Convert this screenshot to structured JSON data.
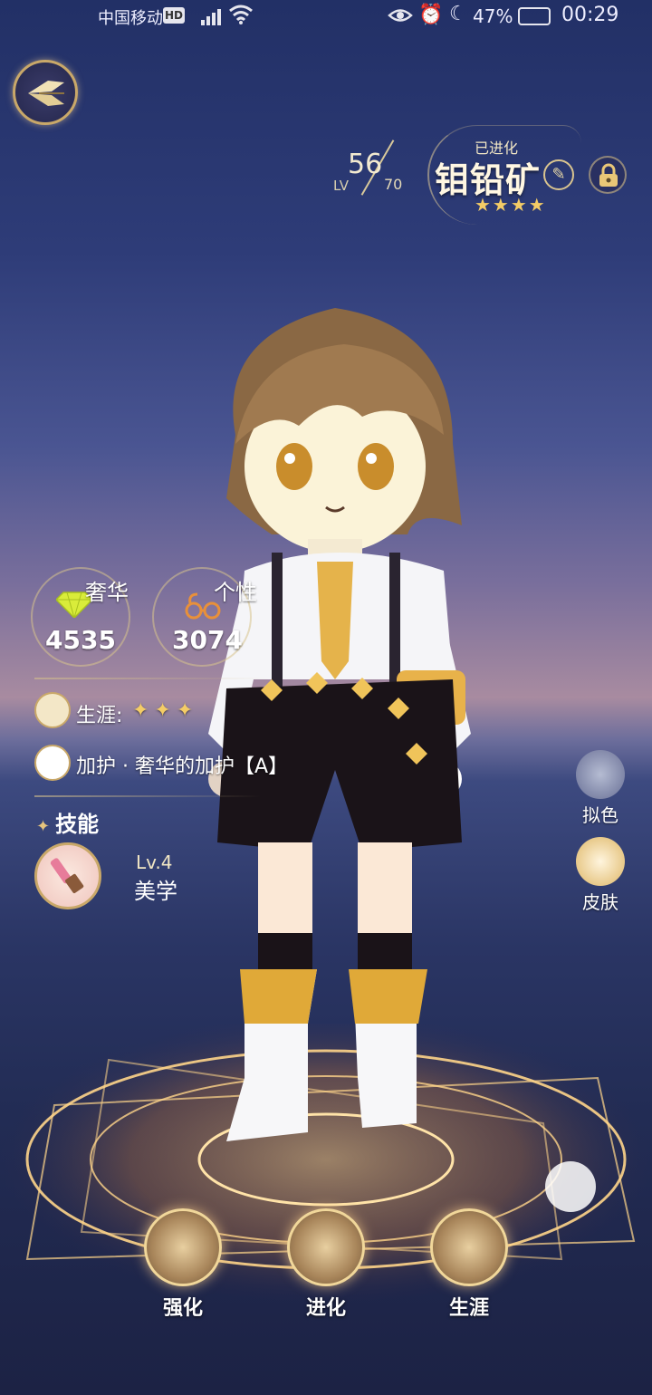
{
  "status_bar": {
    "carrier": "中国移动",
    "hd_badge": "HD",
    "battery_percent": "47%",
    "time": "00:29",
    "icons": [
      "signal-icon",
      "wifi-icon",
      "eye-icon",
      "alarm-icon",
      "moon-icon",
      "battery-icon"
    ]
  },
  "header": {
    "back_icon": "back-wings-icon",
    "level_current": "56",
    "level_label": "LV",
    "level_max": "70",
    "evolved_label": "已进化",
    "character_name": "钼铅矿",
    "rarity_stars": "★★★★",
    "edit_icon": "pencil-icon",
    "lock_icon": "lock-icon"
  },
  "attributes": {
    "luxury_label": "奢华",
    "luxury_value": "4535",
    "personality_label": "个性",
    "personality_value": "3074"
  },
  "career": {
    "label": "生涯:",
    "stars": "✦✦✦"
  },
  "blessing": {
    "text": "加护 · 奢华的加护【A】"
  },
  "skills": {
    "title": "技能",
    "items": [
      {
        "level": "Lv.4",
        "name": "美学",
        "icon": "paintbrush-icon"
      }
    ]
  },
  "side_actions": [
    {
      "label": "拟色",
      "icon": "palette-icon"
    },
    {
      "label": "皮肤",
      "icon": "skin-icon"
    }
  ],
  "bottom_actions": [
    {
      "label": "强化",
      "icon": "planet-icon"
    },
    {
      "label": "进化",
      "icon": "evolve-icon"
    },
    {
      "label": "生涯",
      "icon": "career-book-icon"
    }
  ],
  "colors": {
    "gold_accent": "#c9a869",
    "star_gold": "#f4cc66",
    "sky_top": "#223066",
    "sky_horizon": "#a88ba0"
  }
}
